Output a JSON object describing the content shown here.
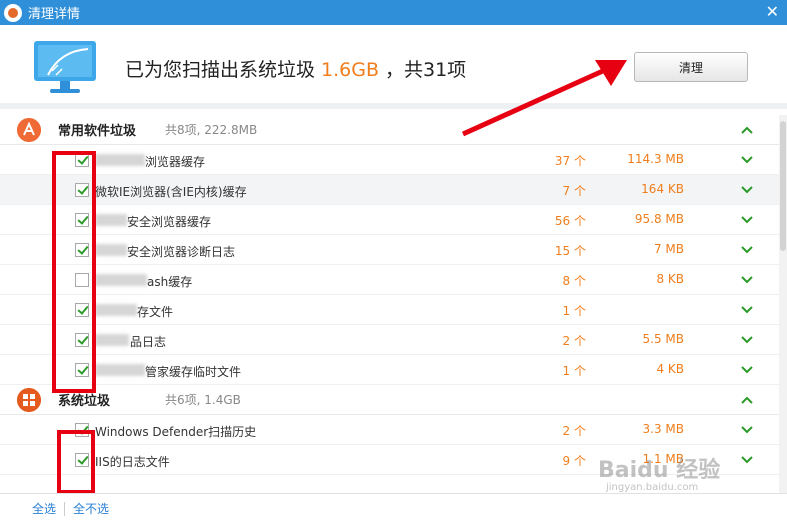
{
  "window": {
    "title": "清理详情",
    "close_glyph": "✕"
  },
  "header": {
    "summary_prefix": "已为您扫描出系统垃圾",
    "summary_size": "1.6GB",
    "summary_suffix": "，共31项",
    "clean_label": "清理"
  },
  "groups": [
    {
      "title": "常用软件垃圾",
      "meta": "共8项, 222.8MB",
      "items": [
        {
          "label": "浏览器缓存",
          "count": "37 个",
          "size": "114.3 MB",
          "checked": true
        },
        {
          "label": "微软IE浏览器(含IE内核)缓存",
          "count": "7 个",
          "size": "164 KB",
          "checked": true
        },
        {
          "label": "安全浏览器缓存",
          "count": "56 个",
          "size": "95.8 MB",
          "checked": true
        },
        {
          "label": "安全浏览器诊断日志",
          "count": "15 个",
          "size": "7 MB",
          "checked": true
        },
        {
          "label": "ash缓存",
          "count": "8 个",
          "size": "8 KB",
          "checked": false
        },
        {
          "label": "存文件",
          "count": "1 个",
          "size": "",
          "checked": true
        },
        {
          "label": "品日志",
          "count": "2 个",
          "size": "5.5 MB",
          "checked": true
        },
        {
          "label": "管家缓存临时文件",
          "count": "1 个",
          "size": "4 KB",
          "checked": true
        }
      ]
    },
    {
      "title": "系统垃圾",
      "meta": "共6项, 1.4GB",
      "items": [
        {
          "label": "Windows Defender扫描历史",
          "count": "2 个",
          "size": "3.3 MB",
          "checked": true
        },
        {
          "label": "IIS的日志文件",
          "count": "9 个",
          "size": "1.1 MB",
          "checked": true
        }
      ]
    }
  ],
  "footer": {
    "select_all": "全选",
    "select_none": "全不选"
  },
  "watermark": {
    "line1": "Baidu 经验",
    "line2": "jingyan.baidu.com"
  },
  "colors": {
    "accent": "#2f8fd8",
    "orange": "#f07e1d",
    "annotation_red": "#e60012",
    "check_green": "#2c9a28"
  }
}
